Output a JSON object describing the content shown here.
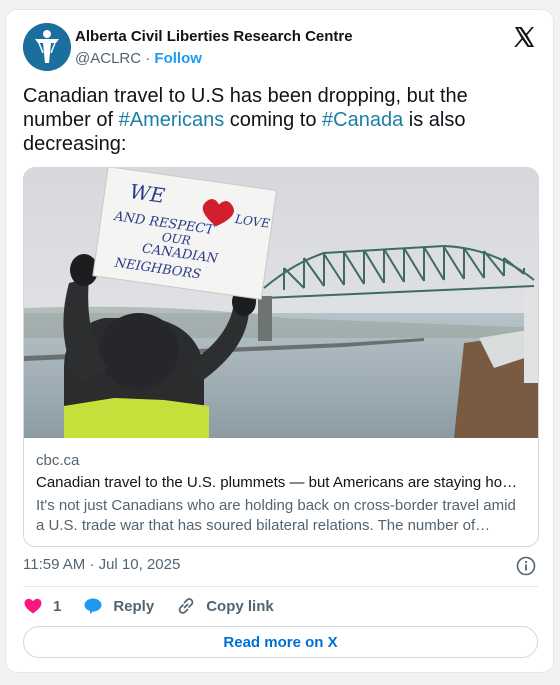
{
  "author": {
    "name": "Alberta Civil Liberties Research Centre",
    "handle": "@ACLRC",
    "separator": "·",
    "follow_label": "Follow"
  },
  "tweet": {
    "text_part1": "Canadian travel to U.S has been dropping, but the number of ",
    "hashtag1": "#Americans",
    "text_part2": " coming to ",
    "hashtag2": "#Canada",
    "text_part3": " is also decreasing:"
  },
  "link_card": {
    "sign_text_line1": "WE",
    "sign_text_line2": "LOVE",
    "sign_text_line3": "AND RESPECT",
    "sign_text_line4": "OUR",
    "sign_text_line5": "CANADIAN",
    "sign_text_line6": "NEIGHBORS",
    "domain": "cbc.ca",
    "title": "Canadian travel to the U.S. plummets — but Americans are staying home too",
    "description": "It's not just Canadians who are holding back on cross-border travel amid a U.S. trade war that has soured bilateral relations. The number of Americans visiting Canada is also dropping."
  },
  "meta": {
    "timestamp": "11:59 AM · Jul 10, 2025"
  },
  "actions": {
    "like_count": "1",
    "reply_label": "Reply",
    "copy_link_label": "Copy link"
  },
  "read_more_label": "Read more on X",
  "colors": {
    "accent_link": "#1b7fa6",
    "follow": "#1d9bf0",
    "heart": "#f91880",
    "reply_bubble": "#1d9bf0"
  }
}
